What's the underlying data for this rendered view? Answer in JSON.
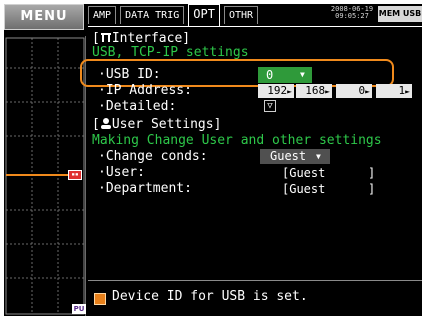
{
  "menu": {
    "label": "MENU"
  },
  "tabs": [
    {
      "label": "AMP",
      "active": false
    },
    {
      "label": "DATA TRIG",
      "active": false
    },
    {
      "label": "OPT",
      "active": true
    },
    {
      "label": "OTHR",
      "active": false
    }
  ],
  "status": {
    "date": "2008-06-19",
    "time": "09:05:27",
    "mem_label": "MEM USB"
  },
  "interface": {
    "header": "[ Interface]",
    "icon": "interface-icon",
    "subtitle": "USB, TCP-IP settings",
    "usb_id_label": "USB ID:",
    "usb_id_value": "0",
    "ip_label": "IP Address:",
    "ip_octets": [
      "192",
      "168",
      "0",
      "1"
    ],
    "detailed_label": "Detailed:",
    "detailed_icon": "chevron-down-icon"
  },
  "user_settings": {
    "header": "[ User Settings]",
    "icon": "user-icon",
    "subtitle": "Making Change User and other settings",
    "change_conds_label": "Change conds:",
    "change_conds_value": "Guest",
    "user_label": "User:",
    "user_value": "[Guest",
    "user_close": "]",
    "department_label": "Department:",
    "department_value": "[Guest",
    "department_close": "]"
  },
  "message": {
    "text": "Device ID for USB is set.",
    "icon": "info-icon"
  },
  "left_panel": {
    "marker_icon": "trigger-marker-icon",
    "channel_label": "PU"
  },
  "colors": {
    "accent_green": "#2ec84a",
    "highlight_orange": "#f08a1c",
    "selection_green": "#2f9a3a"
  }
}
